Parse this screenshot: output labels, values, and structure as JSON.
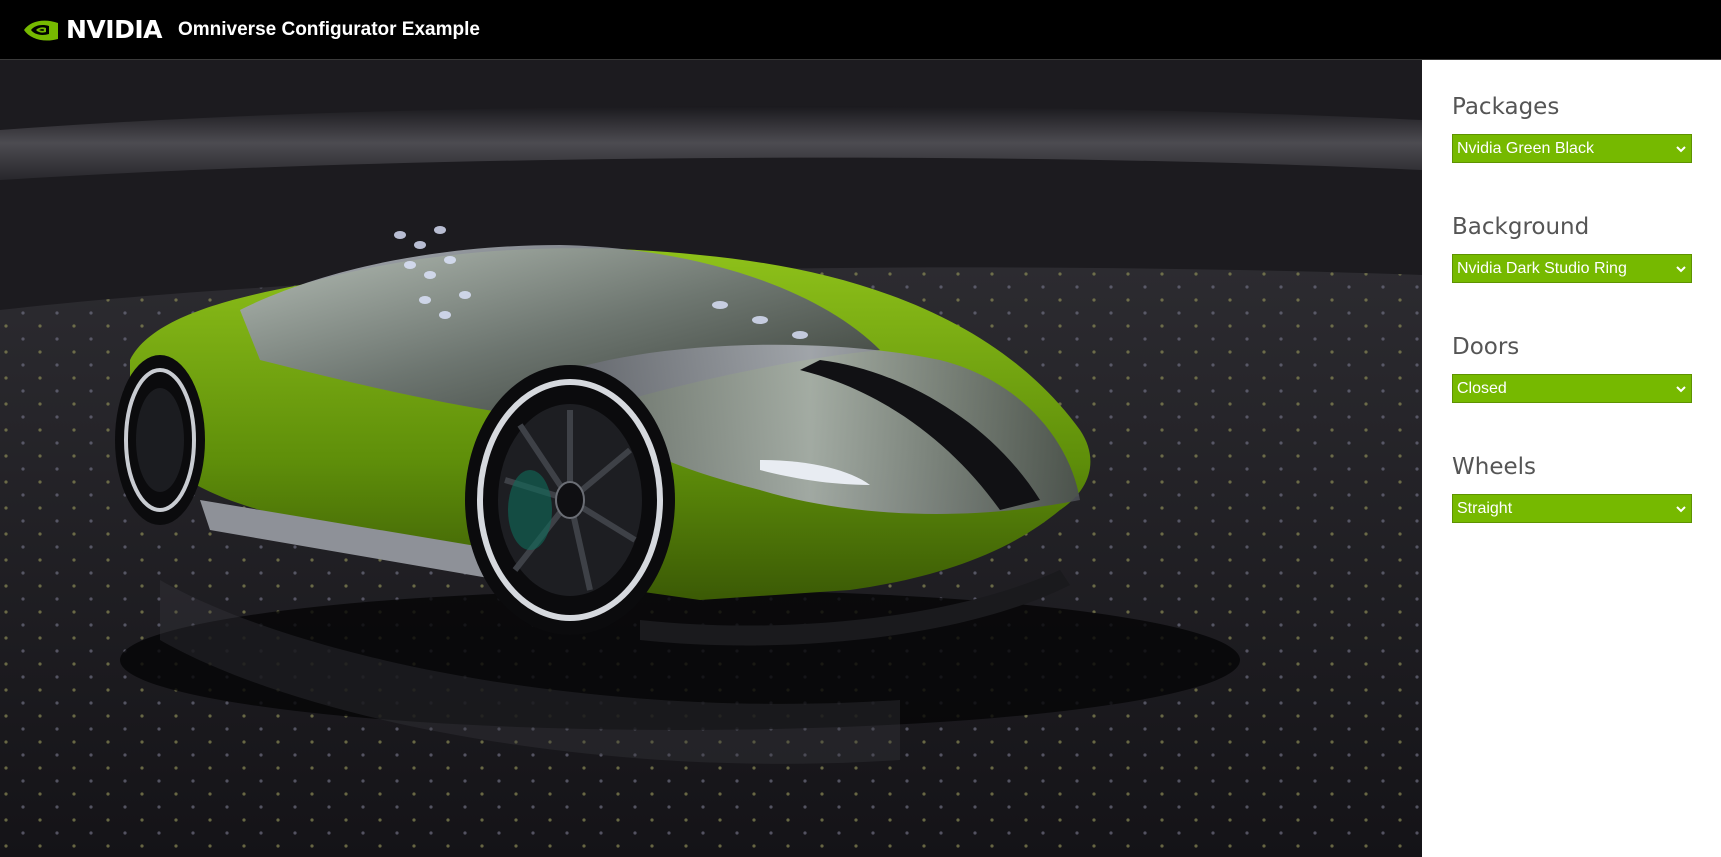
{
  "header": {
    "brand": "NVIDIA",
    "title": "Omniverse Configurator Example",
    "logo_icon": "nvidia-eye-icon"
  },
  "colors": {
    "accent": "#76b900",
    "header_bg": "#000000",
    "panel_bg": "#ffffff",
    "label_text": "#555555"
  },
  "viewport": {
    "scene": "green and black concept sports car in dark studio ring"
  },
  "options": {
    "packages": {
      "label": "Packages",
      "value": "Nvidia Green Black"
    },
    "background": {
      "label": "Background",
      "value": "Nvidia Dark Studio Ring"
    },
    "doors": {
      "label": "Doors",
      "value": "Closed"
    },
    "wheels": {
      "label": "Wheels",
      "value": "Straight"
    }
  }
}
